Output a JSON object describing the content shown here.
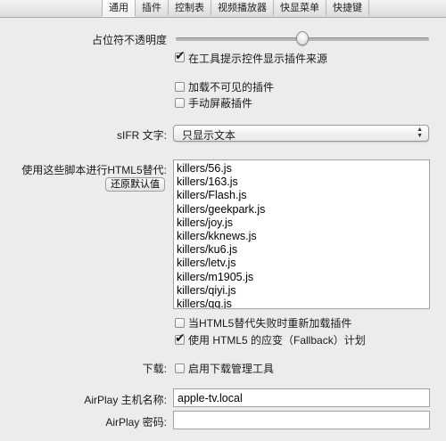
{
  "tabs": [
    {
      "label": "通用",
      "active": true
    },
    {
      "label": "插件"
    },
    {
      "label": "控制表"
    },
    {
      "label": "视频播放器"
    },
    {
      "label": "快显菜单"
    },
    {
      "label": "快捷键"
    }
  ],
  "opacity": {
    "label": "占位符不透明度",
    "value": 0.5
  },
  "show_plugin_source": {
    "label": "在工具提示控件显示插件来源",
    "checked": true
  },
  "load_invisible": {
    "label": "加载不可见的插件",
    "checked": false
  },
  "manual_block": {
    "label": "手动屏蔽插件",
    "checked": false
  },
  "sifr": {
    "label": "sIFR 文字:",
    "selected": "只显示文本"
  },
  "html5": {
    "label": "使用这些脚本进行HTML5替代:",
    "reset_button": "还原默认值",
    "scripts": [
      "killers/56.js",
      "killers/163.js",
      "killers/Flash.js",
      "killers/geekpark.js",
      "killers/joy.js",
      "killers/kknews.js",
      "killers/ku6.js",
      "killers/letv.js",
      "killers/m1905.js",
      "killers/qiyi.js",
      "killers/qq.js"
    ]
  },
  "reload_on_fail": {
    "label": "当HTML5替代失败时重新加载插件",
    "checked": false
  },
  "use_fallback": {
    "label": "使用 HTML5 的应变（Fallback）计划",
    "checked": true
  },
  "download": {
    "label": "下载:",
    "option_label": "启用下载管理工具",
    "checked": false
  },
  "airplay": {
    "host_label": "AirPlay 主机名称:",
    "host_value": "apple-tv.local",
    "password_label": "AirPlay 密码:",
    "password_value": ""
  },
  "icons": {
    "check": "✔",
    "select_arrows": "▲▼"
  }
}
